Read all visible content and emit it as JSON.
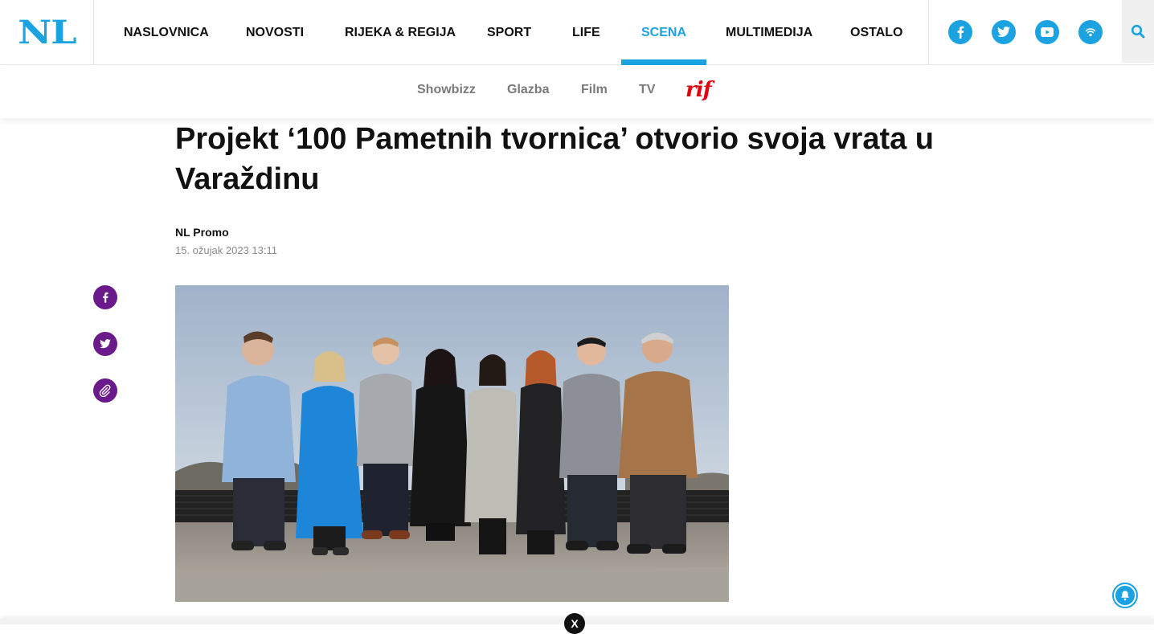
{
  "brand": {
    "logo_text": "NL",
    "accent": "#1aa3e0",
    "share_color": "#6b1a8c",
    "rif_color": "#e3000f"
  },
  "main_nav": [
    {
      "label": "NASLOVNICA",
      "active": false
    },
    {
      "label": "NOVOSTI",
      "active": false
    },
    {
      "label": "RIJEKA & REGIJA",
      "active": false
    },
    {
      "label": "SPORT",
      "active": false
    },
    {
      "label": "LIFE",
      "active": false
    },
    {
      "label": "SCENA",
      "active": true
    },
    {
      "label": "MULTIMEDIJA",
      "active": false
    },
    {
      "label": "OSTALO",
      "active": false
    }
  ],
  "social_icons": [
    "facebook-icon",
    "twitter-icon",
    "youtube-icon",
    "podcast-icon"
  ],
  "search_icon": "search-icon",
  "sub_nav": [
    {
      "label": "Showbizz"
    },
    {
      "label": "Glazba"
    },
    {
      "label": "Film"
    },
    {
      "label": "TV"
    },
    {
      "label": "rif"
    }
  ],
  "article": {
    "title": "Projekt ‘100 Pametnih tvornica’ otvorio svoja vrata u Varaždinu",
    "author": "NL Promo",
    "date": "15. ožujak 2023 13:11"
  },
  "share_icons": [
    "facebook-icon",
    "twitter-icon",
    "link-icon"
  ],
  "close_label": "X"
}
